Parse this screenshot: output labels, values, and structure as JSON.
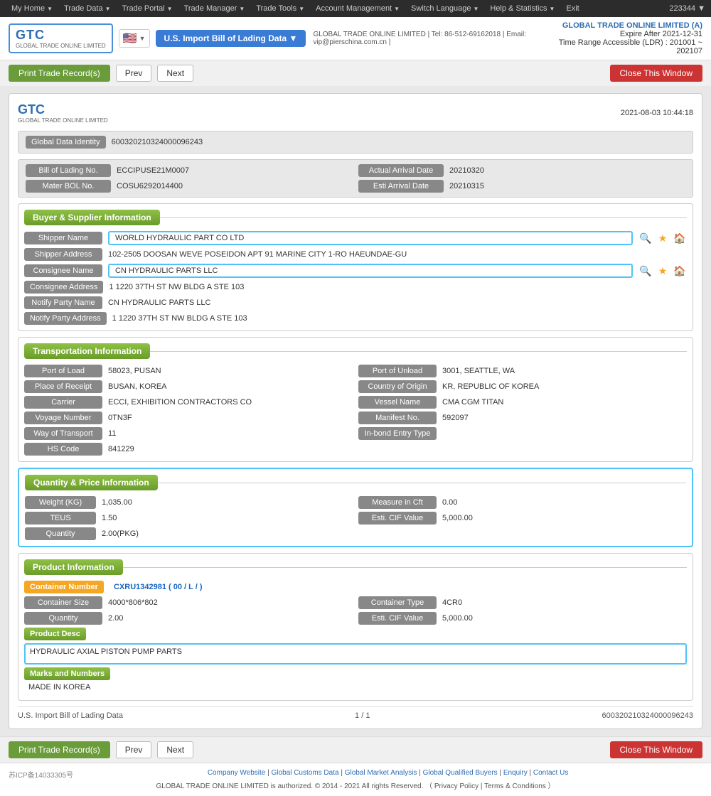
{
  "nav": {
    "items": [
      {
        "label": "My Home",
        "id": "my-home"
      },
      {
        "label": "Trade Data",
        "id": "trade-data"
      },
      {
        "label": "Trade Portal",
        "id": "trade-portal"
      },
      {
        "label": "Trade Manager",
        "id": "trade-manager"
      },
      {
        "label": "Trade Tools",
        "id": "trade-tools"
      },
      {
        "label": "Account Management",
        "id": "account-management"
      },
      {
        "label": "Switch Language",
        "id": "switch-language"
      },
      {
        "label": "Help & Statistics",
        "id": "help-statistics"
      },
      {
        "label": "Exit",
        "id": "exit"
      }
    ],
    "user_id": "223344 ▼"
  },
  "header": {
    "logo_text": "GTC",
    "logo_sub": "GLOBAL TRADE ONLINE LIMITED",
    "db_selector": "U.S. Import Bill of Lading Data ▼",
    "db_info_line1": "GLOBAL TRADE ONLINE LIMITED | Tel: 86-512-69162018 | Email: vip@pierschina.com.cn |",
    "company_name": "GLOBAL TRADE ONLINE LIMITED (A)",
    "expire_after": "Expire After 2021-12-31",
    "time_range": "Time Range Accessible (LDR) : 201001 ~ 202107"
  },
  "toolbar": {
    "print_label": "Print Trade Record(s)",
    "prev_label": "Prev",
    "next_label": "Next",
    "close_label": "Close This Window"
  },
  "record": {
    "timestamp": "2021-08-03 10:44:18",
    "global_data_identity_label": "Global Data Identity",
    "global_data_identity_value": "600320210324000096243",
    "bill_of_lading_no_label": "Bill of Lading No.",
    "bill_of_lading_no_value": "ECCIPUSE21M0007",
    "actual_arrival_date_label": "Actual Arrival Date",
    "actual_arrival_date_value": "20210320",
    "mater_bol_no_label": "Mater BOL No.",
    "mater_bol_no_value": "COSU6292014400",
    "esti_arrival_date_label": "Esti Arrival Date",
    "esti_arrival_date_value": "20210315"
  },
  "buyer_supplier": {
    "title": "Buyer & Supplier Information",
    "shipper_name_label": "Shipper Name",
    "shipper_name_value": "WORLD HYDRAULIC PART CO LTD",
    "shipper_address_label": "Shipper Address",
    "shipper_address_value": "102-2505 DOOSAN WEVE POSEIDON APT 91 MARINE CITY 1-RO HAEUNDAE-GU",
    "consignee_name_label": "Consignee Name",
    "consignee_name_value": "CN HYDRAULIC PARTS LLC",
    "consignee_address_label": "Consignee Address",
    "consignee_address_value": "1 1220 37TH ST NW BLDG A STE 103",
    "notify_party_name_label": "Notify Party Name",
    "notify_party_name_value": "CN HYDRAULIC PARTS LLC",
    "notify_party_address_label": "Notify Party Address",
    "notify_party_address_value": "1 1220 37TH ST NW BLDG A STE 103"
  },
  "transportation": {
    "title": "Transportation Information",
    "port_of_load_label": "Port of Load",
    "port_of_load_value": "58023, PUSAN",
    "port_of_unload_label": "Port of Unload",
    "port_of_unload_value": "3001, SEATTLE, WA",
    "place_of_receipt_label": "Place of Receipt",
    "place_of_receipt_value": "BUSAN, KOREA",
    "country_of_origin_label": "Country of Origin",
    "country_of_origin_value": "KR, REPUBLIC OF KOREA",
    "carrier_label": "Carrier",
    "carrier_value": "ECCI, EXHIBITION CONTRACTORS CO",
    "vessel_name_label": "Vessel Name",
    "vessel_name_value": "CMA CGM TITAN",
    "voyage_number_label": "Voyage Number",
    "voyage_number_value": "0TN3F",
    "manifest_no_label": "Manifest No.",
    "manifest_no_value": "592097",
    "way_of_transport_label": "Way of Transport",
    "way_of_transport_value": "11",
    "in_bond_entry_type_label": "In-bond Entry Type",
    "in_bond_entry_type_value": "",
    "hs_code_label": "HS Code",
    "hs_code_value": "841229"
  },
  "quantity_price": {
    "title": "Quantity & Price Information",
    "weight_kg_label": "Weight (KG)",
    "weight_kg_value": "1,035.00",
    "measure_in_cft_label": "Measure in Cft",
    "measure_in_cft_value": "0.00",
    "teus_label": "TEUS",
    "teus_value": "1.50",
    "esti_cif_value_label": "Esti. CIF Value",
    "esti_cif_value_value": "5,000.00",
    "quantity_label": "Quantity",
    "quantity_value": "2.00(PKG)"
  },
  "product": {
    "title": "Product Information",
    "container_number_label": "Container Number",
    "container_number_value": "CXRU1342981 ( 00 / L / )",
    "container_size_label": "Container Size",
    "container_size_value": "4000*806*802",
    "container_type_label": "Container Type",
    "container_type_value": "4CR0",
    "quantity_label": "Quantity",
    "quantity_value": "2.00",
    "esti_cif_value_label": "Esti. CIF Value",
    "esti_cif_value_value": "5,000.00",
    "product_desc_label": "Product Desc",
    "product_desc_value": "HYDRAULIC AXIAL PISTON PUMP PARTS",
    "marks_and_numbers_label": "Marks and Numbers",
    "marks_and_numbers_value": "MADE IN KOREA"
  },
  "card_footer": {
    "source": "U.S. Import Bill of Lading Data",
    "page": "1 / 1",
    "record_id": "600320210324000096243"
  },
  "footer": {
    "links": [
      "Company Website",
      "Global Customs Data",
      "Global Market Analysis",
      "Global Qualified Buyers",
      "Enquiry",
      "Contact Us"
    ],
    "copyright": "GLOBAL TRADE ONLINE LIMITED is authorized. © 2014 - 2021 All rights Reserved.  （ Privacy Policy | Terms & Conditions ）",
    "icp": "苏ICP备14033305号"
  }
}
